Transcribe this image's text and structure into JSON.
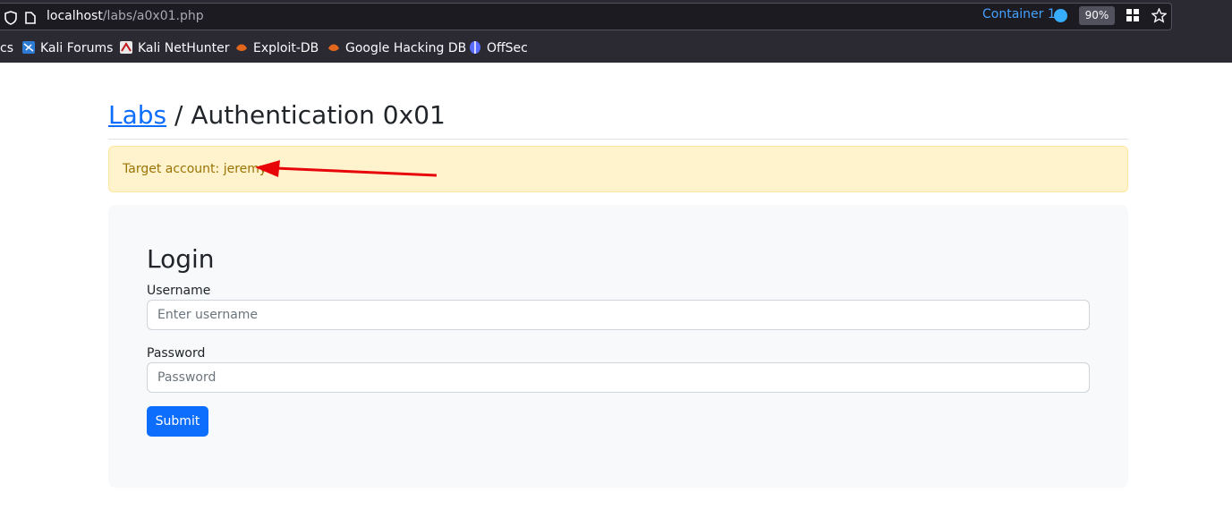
{
  "browser": {
    "url_host": "localhost",
    "url_path": "/labs/a0x01.php",
    "container_label": "Container 1",
    "zoom": "90%",
    "bookmarks": [
      {
        "label": "cs",
        "icon": "truncated"
      },
      {
        "label": "Kali Forums",
        "icon": "kali-forums-icon"
      },
      {
        "label": "Kali NetHunter",
        "icon": "kali-nethunter-icon"
      },
      {
        "label": "Exploit-DB",
        "icon": "exploit-db-icon"
      },
      {
        "label": "Google Hacking DB",
        "icon": "ghdb-icon"
      },
      {
        "label": "OffSec",
        "icon": "offsec-icon"
      }
    ]
  },
  "page": {
    "breadcrumb_link": "Labs",
    "breadcrumb_rest": " / Authentication 0x01",
    "alert": "Target account: jeremy",
    "login": {
      "title": "Login",
      "username_label": "Username",
      "username_placeholder": "Enter username",
      "password_label": "Password",
      "password_placeholder": "Password",
      "submit_label": "Submit"
    }
  },
  "colors": {
    "primary": "#0d6efd",
    "alert_bg": "#fff3cd",
    "alert_text": "#997404",
    "annotation_arrow": "#e8050a"
  }
}
